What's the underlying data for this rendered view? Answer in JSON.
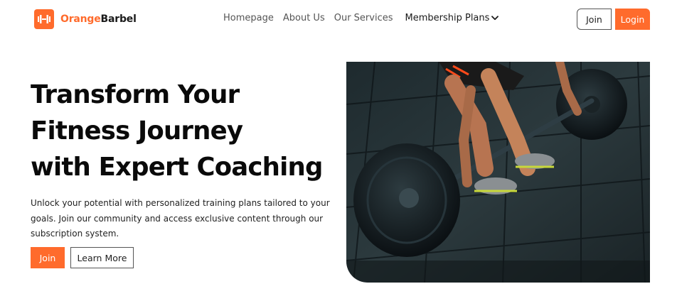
{
  "brand": {
    "name_part1": "Orange",
    "name_part2": "Barbel",
    "accent_color": "#ff6b2c",
    "logo_icon": "barbell-icon"
  },
  "nav": {
    "items": [
      "Homepage",
      "About Us",
      "Our Services"
    ],
    "dropdown_label": "Membership Plans",
    "dropdown_icon": "chevron-down-icon"
  },
  "header_actions": {
    "join_label": "Join",
    "login_label": "Login"
  },
  "hero": {
    "title_lines": [
      "Transform Your",
      "Fitness Journey",
      "with Expert Coaching"
    ],
    "description": "Unlock your potential with personalized training plans tailored to your goals. Join our community and access exclusive content through our subscription system.",
    "join_label": "Join",
    "learn_more_label": "Learn More"
  }
}
